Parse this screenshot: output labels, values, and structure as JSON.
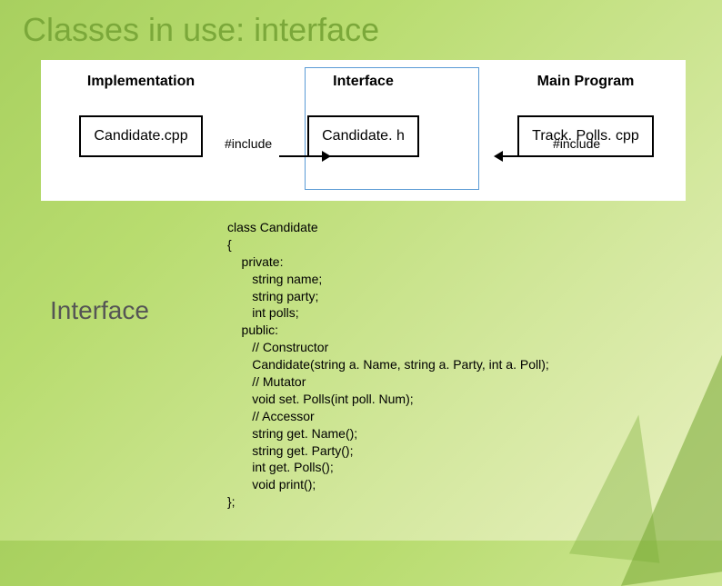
{
  "title": "Classes in use: interface",
  "diagram": {
    "cols": [
      {
        "label": "Implementation",
        "box": "Candidate.cpp"
      },
      {
        "label": "Interface",
        "box": "Candidate. h"
      },
      {
        "label": "Main Program",
        "box": "Track. Polls. cpp"
      }
    ],
    "arrow_label": "#include"
  },
  "section_label": "Interface",
  "code": "class Candidate\n{\n    private:\n       string name;\n       string party;\n       int polls;\n    public:\n       // Constructor\n       Candidate(string a. Name, string a. Party, int a. Poll);\n       // Mutator\n       void set. Polls(int poll. Num);\n       // Accessor\n       string get. Name();\n       string get. Party();\n       int get. Polls();\n       void print();\n};"
}
